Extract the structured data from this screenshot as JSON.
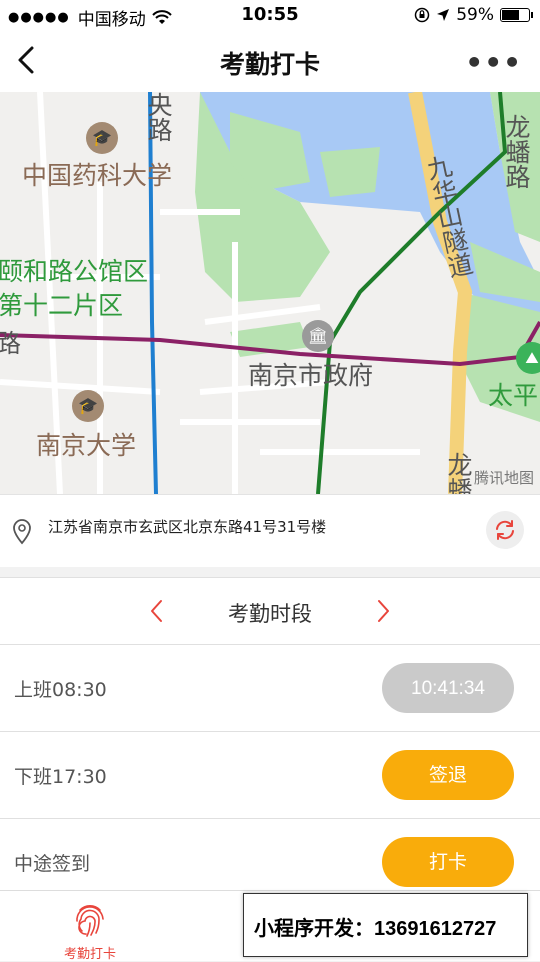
{
  "status_bar": {
    "carrier": "中国移动",
    "time": "10:55",
    "battery": "59%"
  },
  "header": {
    "title": "考勤打卡",
    "back_icon": "chevron-left-icon",
    "more_icon": "more-dots-icon"
  },
  "map": {
    "labels": {
      "zhongyang_road": "央路",
      "pharma_university": "中国药科大学",
      "yiheroad": "颐和路公馆区",
      "district12": "第十二片区",
      "road_left": "路",
      "city_hall": "南京市政府",
      "nanjing_university": "南京大学",
      "jiuhuashan_tunnel": "九华山隧道",
      "longpan_road": "龙蟠路",
      "taiping": "太平",
      "long_bottom": "龙蟠"
    },
    "provider": "腾讯地图"
  },
  "location": {
    "address": "江苏省南京市玄武区北京东路41号31号楼",
    "pin_icon": "location-pin-icon",
    "refresh_icon": "refresh-icon"
  },
  "attendance": {
    "period_title": "考勤时段",
    "rows": [
      {
        "label": "上班08:30",
        "action": "10:41:34"
      },
      {
        "label": "下班17:30",
        "action": "签退"
      },
      {
        "label": "中途签到",
        "action": "打卡"
      }
    ]
  },
  "tabs": {
    "active": "考勤打卡",
    "active_icon": "fingerprint-icon"
  },
  "overlay": {
    "text": "小程序开发：13691612727"
  },
  "colors": {
    "accent": "#f9ac0b",
    "tab_active": "#e8453c",
    "disabled": "#cacaca"
  }
}
